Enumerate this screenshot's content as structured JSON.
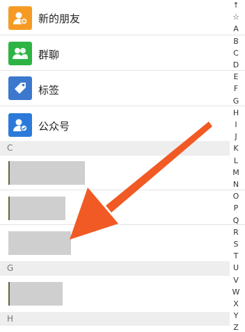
{
  "menu_items": [
    {
      "label": "新的朋友",
      "icon": "add-friend-icon",
      "color": "#f59b24"
    },
    {
      "label": "群聊",
      "icon": "group-chat-icon",
      "color": "#2eb446"
    },
    {
      "label": "标签",
      "icon": "tag-icon",
      "color": "#3d78cf"
    },
    {
      "label": "公众号",
      "icon": "official-account-icon",
      "color": "#2b7ad9"
    }
  ],
  "sections": [
    "C",
    "G",
    "H"
  ],
  "index_letters": [
    "↑",
    "☆",
    "A",
    "B",
    "C",
    "D",
    "E",
    "F",
    "G",
    "H",
    "I",
    "J",
    "K",
    "L",
    "M",
    "N",
    "O",
    "P",
    "Q",
    "R",
    "S",
    "T",
    "U",
    "V",
    "W",
    "X",
    "Y",
    "Z"
  ],
  "colors": {
    "annotation_arrow": "#f15a24",
    "section_bg": "#eeeeee",
    "redaction": "#cfcfcf"
  }
}
